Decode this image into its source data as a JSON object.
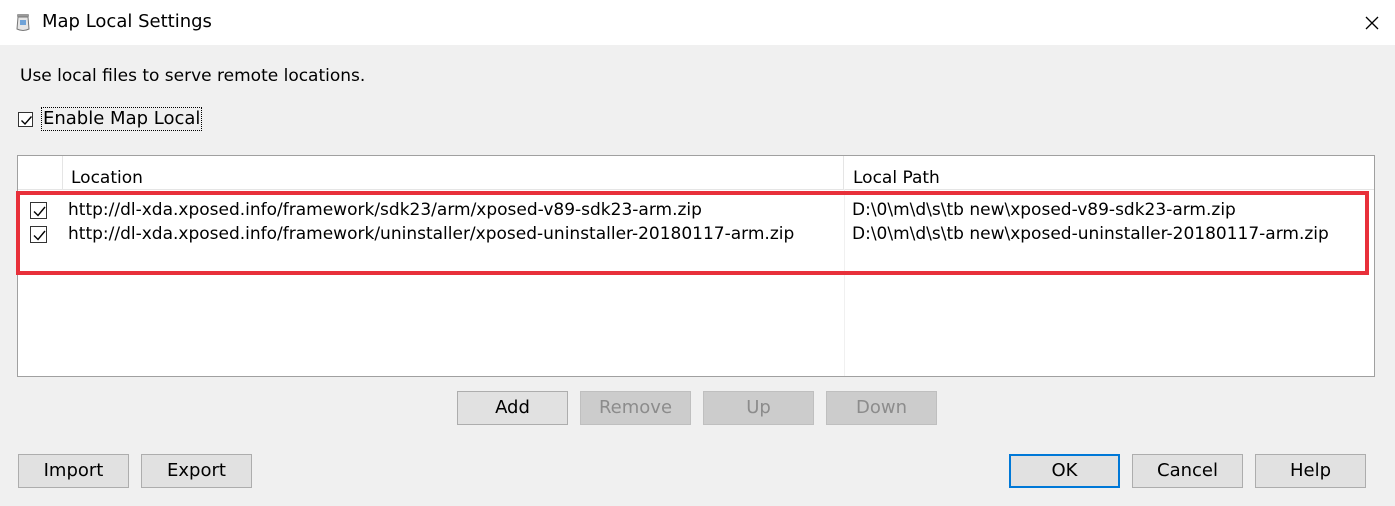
{
  "window": {
    "title": "Map Local Settings",
    "icon": "charles-jar-icon",
    "close_glyph": "✕"
  },
  "description": "Use local files to serve remote locations.",
  "enable": {
    "label": "Enable Map Local",
    "checked": true
  },
  "table": {
    "columns": [
      "",
      "Location",
      "Local Path"
    ],
    "rows": [
      {
        "checked": true,
        "location": "http://dl-xda.xposed.info/framework/sdk23/arm/xposed-v89-sdk23-arm.zip",
        "local_path": "D:\\0\\m\\d\\s\\tb  new\\xposed-v89-sdk23-arm.zip"
      },
      {
        "checked": true,
        "location": "http://dl-xda.xposed.info/framework/uninstaller/xposed-uninstaller-20180117-arm.zip",
        "local_path": "D:\\0\\m\\d\\s\\tb  new\\xposed-uninstaller-20180117-arm.zip"
      }
    ]
  },
  "row_buttons": {
    "add": "Add",
    "remove": "Remove",
    "up": "Up",
    "down": "Down"
  },
  "footer_buttons": {
    "import": "Import",
    "export": "Export",
    "ok": "OK",
    "cancel": "Cancel",
    "help": "Help"
  },
  "colors": {
    "highlight": "#e8303a",
    "default_button_border": "#0078d7",
    "disabled_text": "#8c8c8c"
  }
}
